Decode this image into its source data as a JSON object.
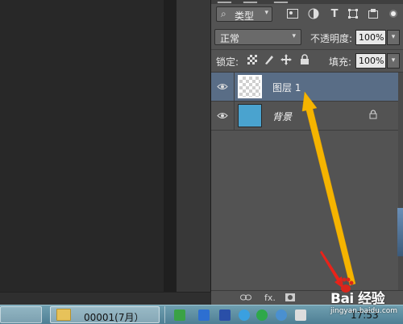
{
  "layers_panel": {
    "filter": {
      "label": "类型",
      "dropdown": "▾"
    },
    "blend_mode": {
      "value": "正常",
      "dropdown": "▾"
    },
    "opacity": {
      "label": "不透明度:",
      "value": "100%",
      "dropdown": "▾"
    },
    "lock": {
      "label": "锁定:"
    },
    "fill": {
      "label": "填充:",
      "value": "100%",
      "dropdown": "▾"
    },
    "layers": [
      {
        "name": "图层 1",
        "visible": true,
        "selected": true
      },
      {
        "name": "背景",
        "visible": true,
        "locked": true,
        "color": "#4aa3cf"
      }
    ],
    "bottom_icons": [
      "link-icon",
      "fx-icon",
      "mask-icon",
      "adjustment-icon",
      "folder-icon",
      "new-layer-icon",
      "trash-icon"
    ],
    "fx_label": "fx."
  },
  "taskbar": {
    "folder_label": "00001(7月）",
    "clock": "17:53"
  },
  "watermark": {
    "brand": "Bai 经验",
    "url": "jingyan.baidu.com"
  },
  "colors": {
    "selected_row": "#596d86",
    "panel_bg": "#535353",
    "annotation_arrow_main": "#f5b400",
    "annotation_arrow_small": "#e8231a"
  }
}
